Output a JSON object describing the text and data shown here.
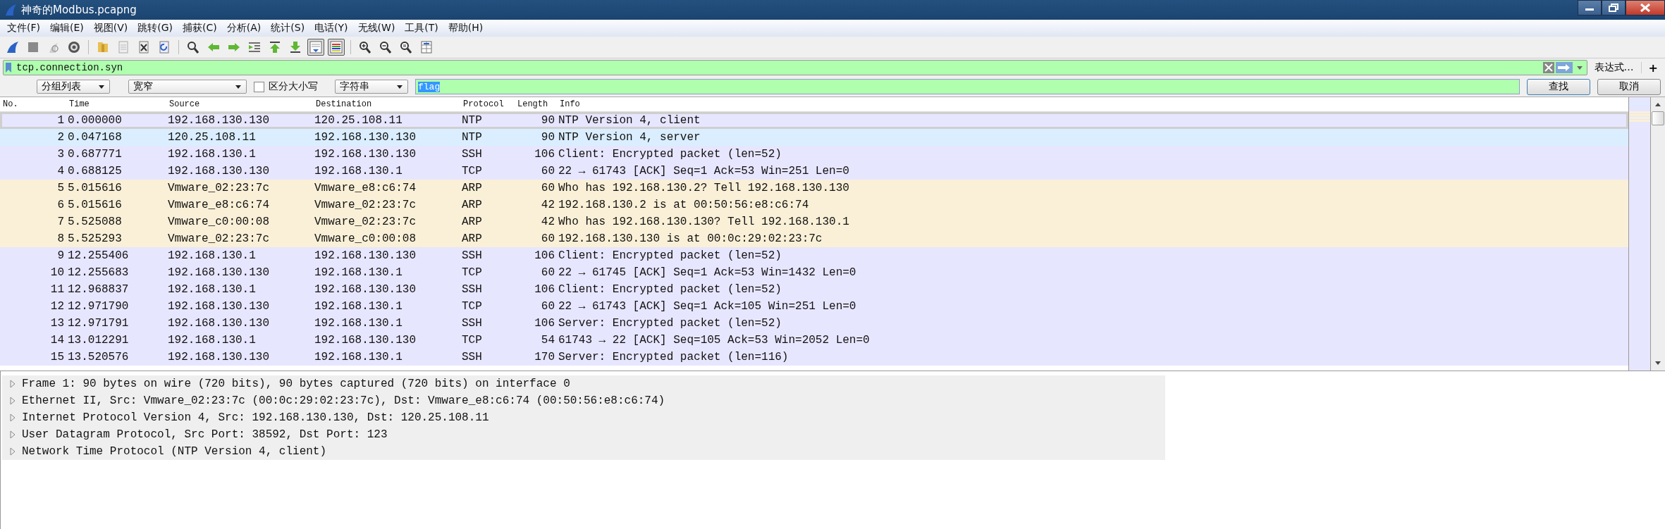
{
  "window": {
    "title": "神奇的Modbus.pcapng"
  },
  "menu": [
    "文件(F)",
    "编辑(E)",
    "视图(V)",
    "跳转(G)",
    "捕获(C)",
    "分析(A)",
    "统计(S)",
    "电话(Y)",
    "无线(W)",
    "工具(T)",
    "帮助(H)"
  ],
  "toolbar": [
    {
      "kind": "fin",
      "pressed": false
    },
    {
      "kind": "stop",
      "pressed": false
    },
    {
      "kind": "restart",
      "pressed": false
    },
    {
      "kind": "options",
      "pressed": false
    },
    {
      "kind": "sep"
    },
    {
      "kind": "open",
      "pressed": false
    },
    {
      "kind": "save",
      "pressed": false
    },
    {
      "kind": "close",
      "pressed": false
    },
    {
      "kind": "reload",
      "pressed": false
    },
    {
      "kind": "sep"
    },
    {
      "kind": "find",
      "pressed": false
    },
    {
      "kind": "back",
      "pressed": false
    },
    {
      "kind": "forward",
      "pressed": false
    },
    {
      "kind": "goto",
      "pressed": false
    },
    {
      "kind": "first",
      "pressed": false
    },
    {
      "kind": "last",
      "pressed": false
    },
    {
      "kind": "autoscroll",
      "pressed": true
    },
    {
      "kind": "colorize",
      "pressed": true
    },
    {
      "kind": "sep"
    },
    {
      "kind": "zoomin",
      "pressed": false
    },
    {
      "kind": "zoomout",
      "pressed": false
    },
    {
      "kind": "zoomreset",
      "pressed": false
    },
    {
      "kind": "resize",
      "pressed": false
    }
  ],
  "display_filter": {
    "value": "tcp.connection.syn",
    "expression_button": "表达式…",
    "add_button": "+"
  },
  "find_bar": {
    "search_in": "分组列表",
    "char_width": "宽窄",
    "case_sensitive": {
      "label": "区分大小写",
      "checked": false
    },
    "search_type": "字符串",
    "value": "flag",
    "find_button": "查找",
    "cancel_button": "取消"
  },
  "packet_list": {
    "columns": [
      "No.",
      "Time",
      "Source",
      "Destination",
      "Protocol",
      "Length",
      "Info"
    ],
    "rows": [
      {
        "cells": [
          "1",
          "0.000000",
          "192.168.130.130",
          "120.25.108.11",
          "NTP",
          "90",
          "NTP Version 4, client"
        ],
        "color": "#e7e6ff",
        "selected": true
      },
      {
        "cells": [
          "2",
          "0.047168",
          "120.25.108.11",
          "192.168.130.130",
          "NTP",
          "90",
          "NTP Version 4, server"
        ],
        "color": "#daeeff",
        "selected": false
      },
      {
        "cells": [
          "3",
          "0.687771",
          "192.168.130.1",
          "192.168.130.130",
          "SSH",
          "106",
          "Client: Encrypted packet (len=52)"
        ],
        "color": "#e7e6ff",
        "selected": false
      },
      {
        "cells": [
          "4",
          "0.688125",
          "192.168.130.130",
          "192.168.130.1",
          "TCP",
          "60",
          "22 → 61743 [ACK] Seq=1 Ack=53 Win=251 Len=0"
        ],
        "color": "#e7e6ff",
        "selected": false
      },
      {
        "cells": [
          "5",
          "5.015616",
          "Vmware_02:23:7c",
          "Vmware_e8:c6:74",
          "ARP",
          "60",
          "Who has 192.168.130.2? Tell 192.168.130.130"
        ],
        "color": "#faf0d7",
        "selected": false
      },
      {
        "cells": [
          "6",
          "5.015616",
          "Vmware_e8:c6:74",
          "Vmware_02:23:7c",
          "ARP",
          "42",
          "192.168.130.2 is at 00:50:56:e8:c6:74"
        ],
        "color": "#faf0d7",
        "selected": false
      },
      {
        "cells": [
          "7",
          "5.525088",
          "Vmware_c0:00:08",
          "Vmware_02:23:7c",
          "ARP",
          "42",
          "Who has 192.168.130.130? Tell 192.168.130.1"
        ],
        "color": "#faf0d7",
        "selected": false
      },
      {
        "cells": [
          "8",
          "5.525293",
          "Vmware_02:23:7c",
          "Vmware_c0:00:08",
          "ARP",
          "60",
          "192.168.130.130 is at 00:0c:29:02:23:7c"
        ],
        "color": "#faf0d7",
        "selected": false
      },
      {
        "cells": [
          "9",
          "12.255406",
          "192.168.130.1",
          "192.168.130.130",
          "SSH",
          "106",
          "Client: Encrypted packet (len=52)"
        ],
        "color": "#e7e6ff",
        "selected": false
      },
      {
        "cells": [
          "10",
          "12.255683",
          "192.168.130.130",
          "192.168.130.1",
          "TCP",
          "60",
          "22 → 61745 [ACK] Seq=1 Ack=53 Win=1432 Len=0"
        ],
        "color": "#e7e6ff",
        "selected": false
      },
      {
        "cells": [
          "11",
          "12.968837",
          "192.168.130.1",
          "192.168.130.130",
          "SSH",
          "106",
          "Client: Encrypted packet (len=52)"
        ],
        "color": "#e7e6ff",
        "selected": false
      },
      {
        "cells": [
          "12",
          "12.971790",
          "192.168.130.130",
          "192.168.130.1",
          "TCP",
          "60",
          "22 → 61743 [ACK] Seq=1 Ack=105 Win=251 Len=0"
        ],
        "color": "#e7e6ff",
        "selected": false
      },
      {
        "cells": [
          "13",
          "12.971791",
          "192.168.130.130",
          "192.168.130.1",
          "SSH",
          "106",
          "Server: Encrypted packet (len=52)"
        ],
        "color": "#e7e6ff",
        "selected": false
      },
      {
        "cells": [
          "14",
          "13.012291",
          "192.168.130.1",
          "192.168.130.130",
          "TCP",
          "54",
          "61743 → 22 [ACK] Seq=105 Ack=53 Win=2052 Len=0"
        ],
        "color": "#e7e6ff",
        "selected": false
      },
      {
        "cells": [
          "15",
          "13.520576",
          "192.168.130.130",
          "192.168.130.1",
          "SSH",
          "170",
          "Server: Encrypted packet (len=116)"
        ],
        "color": "#e7e6ff",
        "selected": false
      }
    ]
  },
  "packet_details": [
    {
      "text": "Frame 1: 90 bytes on wire (720 bits), 90 bytes captured (720 bits) on interface 0",
      "expanded": false
    },
    {
      "text": "Ethernet II, Src: Vmware_02:23:7c (00:0c:29:02:23:7c), Dst: Vmware_e8:c6:74 (00:50:56:e8:c6:74)",
      "expanded": false
    },
    {
      "text": "Internet Protocol Version 4, Src: 192.168.130.130, Dst: 120.25.108.11",
      "expanded": false
    },
    {
      "text": "User Datagram Protocol, Src Port: 38592, Dst Port: 123",
      "expanded": false
    },
    {
      "text": "Network Time Protocol (NTP Version 4, client)",
      "expanded": false
    }
  ]
}
